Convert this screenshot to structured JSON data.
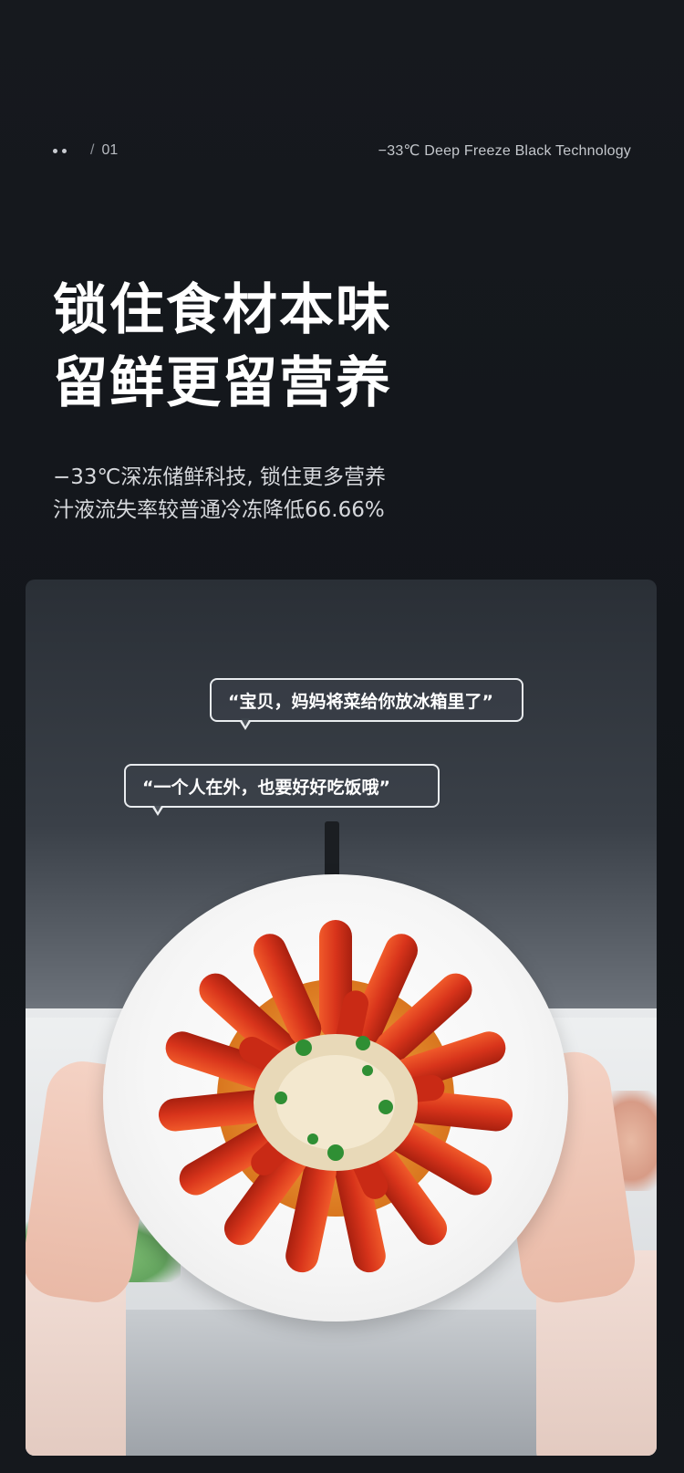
{
  "header": {
    "page_index": "01",
    "separator": "/",
    "tagline": "−33℃ Deep Freeze Black Technology"
  },
  "headline": {
    "line1": "锁住食材本味",
    "line2": "留鲜更留营养"
  },
  "description": {
    "line1": "−33℃深冻储鲜科技, 锁住更多营养",
    "line2": "汁液流失率较普通冷冻降低66.66%"
  },
  "photo": {
    "bubble1": "“宝贝，妈妈将菜给你放冰箱里了”",
    "bubble2": "“一个人在外，也要好好吃饭哦”"
  },
  "colors": {
    "background": "#13161b",
    "headline": "#ffffff",
    "crayfish": "#d8341b",
    "sauce": "#f2a23a"
  }
}
